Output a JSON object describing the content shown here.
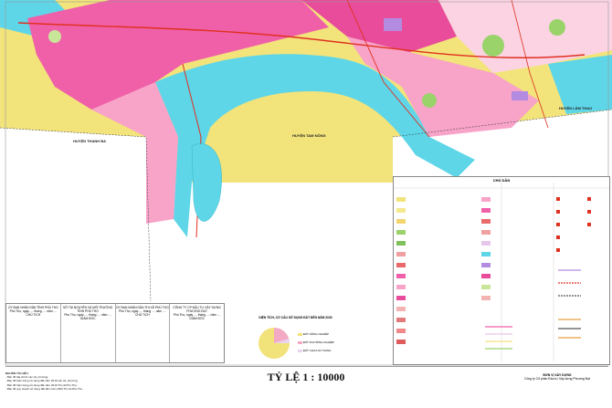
{
  "map_labels": {
    "district_west": "HUYỆN THANH BA",
    "district_center": "HUYỆN TAM NÔNG",
    "district_east": "HUYỆN LÂM THAO"
  },
  "legend": {
    "title": "CHÚ DẪN"
  },
  "signatures": [
    {
      "org": "ỦY BAN NHÂN DÂN TỈNH PHÚ THỌ",
      "line": "Phú Thọ, ngày .... tháng .... năm ....",
      "role": "CHỦ TỊCH"
    },
    {
      "org": "SỞ TÀI NGUYÊN VÀ MÔI TRƯỜNG TỈNH PHÚ THỌ",
      "line": "Phú Thọ, ngày .... tháng .... năm ....",
      "role": "GIÁM ĐỐC"
    },
    {
      "org": "ỦY BAN NHÂN DÂN THỊ XÃ PHÚ THỌ",
      "line": "Phú Thọ, ngày .... tháng .... năm ....",
      "role": "CHỦ TỊCH"
    },
    {
      "org": "CÔNG TY CP ĐẦU TƯ XÂY DỰNG PHƯƠNG ĐẠT",
      "line": "Phú Thọ, ngày .... tháng .... năm ....",
      "role": "GIÁM ĐỐC"
    }
  ],
  "pie": {
    "title": "DIỆN TÍCH, CƠ CẤU SỬ DỤNG ĐẤT ĐẾN NĂM 2030",
    "items": [
      "ĐẤT NÔNG NGHIỆP",
      "ĐẤT PHI NÔNG NGHIỆP",
      "ĐẤT CHƯA SỬ DỤNG"
    ],
    "colors": [
      "#f2e27a",
      "#f4a9c4",
      "#e8d3f0"
    ]
  },
  "notes": {
    "title": "NGUỒN TÀI LIỆU:",
    "lines": [
      "- Bản đồ địa chính các xã, phường;",
      "- Bản đồ hiện trạng sử dụng đất năm 2019 các xã, phường;",
      "- Bản đồ hiện trạng sử dụng đất năm 2019 Thị xã Phú Thọ;",
      "- Bản đồ quy hoạch sử dụng đất đến năm 2020 Thị xã Phú Thọ."
    ]
  },
  "scale": "TỶ LỆ 1 : 10000",
  "org": {
    "title": "ĐƠN VỊ XÂY DỰNG",
    "name": "Công ty Cổ phần Đầu tư Xây dựng Phương Đạt"
  },
  "colors": {
    "water": "#5ed6e8",
    "urban": "#f060a8",
    "residential": "#f8a3c8",
    "agriculture": "#f2e37b",
    "forest": "#9ad36a",
    "road": "#e03020"
  }
}
